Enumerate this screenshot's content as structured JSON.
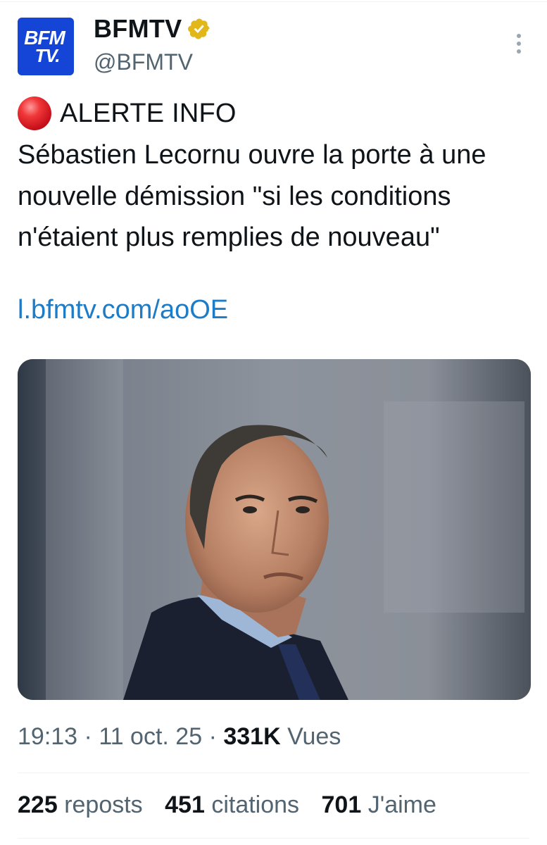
{
  "author": {
    "logo_line1": "BFM",
    "logo_line2": "TV.",
    "name": "BFMTV",
    "verified_icon": "gold-verified-badge-icon",
    "handle": "@BFMTV"
  },
  "tweet": {
    "alert_icon": "red-circle-emoji",
    "alert_label": "ALERTE INFO",
    "text": "Sébastien Lecornu ouvre la porte à une nouvelle démission \"si les conditions n'étaient plus remplies de nouveau\"",
    "link": "l.bfmtv.com/aoOE",
    "photo_icon": "news-photo-man-in-suit"
  },
  "meta": {
    "time": "19:13",
    "sep": " · ",
    "date": "11 oct. 25",
    "views_count": "331K",
    "views_label": "Vues"
  },
  "stats": {
    "reposts_count": "225",
    "reposts_label": "reposts",
    "quotes_count": "451",
    "quotes_label": "citations",
    "likes_count": "701",
    "likes_label": "J'aime"
  },
  "colors": {
    "link": "#1d7cc8",
    "logo_bg": "#1545d6",
    "secondary_text": "#536471"
  }
}
